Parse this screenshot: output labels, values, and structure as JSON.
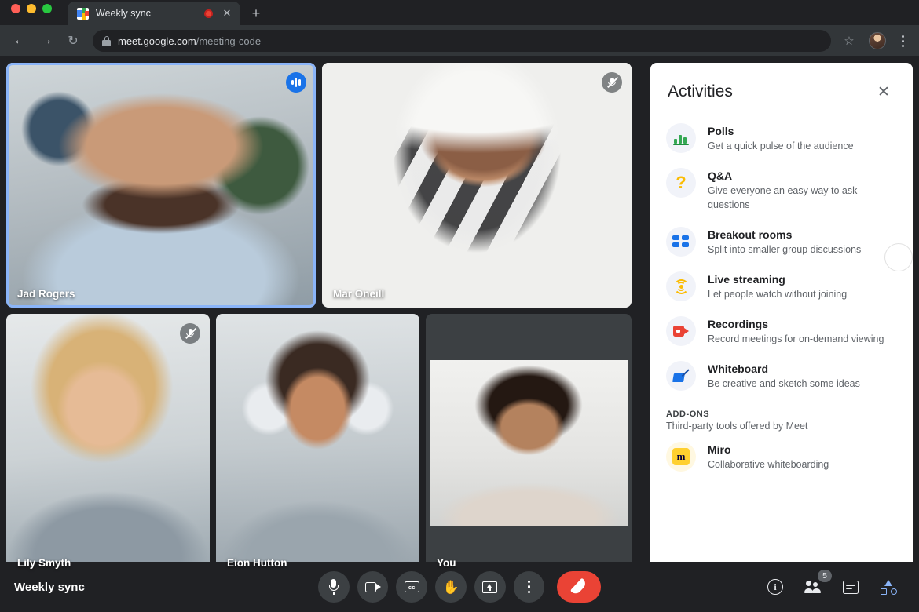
{
  "browser": {
    "tab": {
      "title": "Weekly sync",
      "favicon": "google-meet-favicon",
      "recording_indicator": "recording-dot",
      "close": "✕"
    },
    "new_tab": "+",
    "nav": {
      "back": "←",
      "forward": "→",
      "reload": "↻"
    },
    "omnibox": {
      "lock": "lock-icon",
      "domain": "meet.google.com",
      "path": "/meeting-code",
      "star": "☆"
    },
    "menu": "kebab-menu"
  },
  "meeting": {
    "title": "Weekly sync",
    "tiles": [
      {
        "name": "Jad Rogers",
        "mic": "on",
        "speaking": true,
        "style": "p-jad"
      },
      {
        "name": "Mar Oneill",
        "mic": "off",
        "speaking": false,
        "style": "p-mar"
      },
      {
        "name": "Lily Smyth",
        "mic": "off",
        "speaking": false,
        "style": "p-lily"
      },
      {
        "name": "Eion Hutton",
        "mic": "none",
        "speaking": false,
        "style": "p-eion"
      },
      {
        "name": "You",
        "mic": "none",
        "speaking": false,
        "style": "p-you"
      }
    ]
  },
  "panel": {
    "title": "Activities",
    "close_label": "✕",
    "items": [
      {
        "title": "Polls",
        "subtitle": "Get a quick pulse of the audience",
        "icon": "polls-icon"
      },
      {
        "title": "Q&A",
        "subtitle": "Give everyone an easy way to ask questions",
        "icon": "qa-icon"
      },
      {
        "title": "Breakout rooms",
        "subtitle": "Split into smaller group discussions",
        "icon": "breakout-rooms-icon"
      },
      {
        "title": "Live streaming",
        "subtitle": "Let people watch without joining",
        "icon": "live-streaming-icon"
      },
      {
        "title": "Recordings",
        "subtitle": "Record meetings for on-demand viewing",
        "icon": "recordings-icon"
      },
      {
        "title": "Whiteboard",
        "subtitle": "Be creative and sketch some ideas",
        "icon": "whiteboard-icon"
      }
    ],
    "addons": {
      "label": "ADD-ONS",
      "subtitle": "Third-party tools offered by Meet",
      "items": [
        {
          "title": "Miro",
          "subtitle": "Collaborative whiteboarding",
          "icon": "miro-icon",
          "glyph": "m"
        }
      ]
    }
  },
  "toolbar": {
    "center": [
      {
        "name": "microphone-button",
        "icon": "mic-icon"
      },
      {
        "name": "camera-button",
        "icon": "camera-icon"
      },
      {
        "name": "captions-button",
        "icon": "cc-icon",
        "glyph": "cc"
      },
      {
        "name": "raise-hand-button",
        "icon": "hand-icon",
        "glyph": "✋"
      },
      {
        "name": "present-screen-button",
        "icon": "present-icon"
      },
      {
        "name": "more-options-button",
        "icon": "more-vertical-icon"
      },
      {
        "name": "leave-call-button",
        "icon": "hangup-icon"
      }
    ],
    "right": [
      {
        "name": "meeting-details-button",
        "icon": "info-icon",
        "glyph": "i"
      },
      {
        "name": "participants-button",
        "icon": "people-icon",
        "badge": "5"
      },
      {
        "name": "chat-button",
        "icon": "chat-icon"
      },
      {
        "name": "activities-button",
        "icon": "activities-icon",
        "active": true
      }
    ]
  },
  "colors": {
    "accent_blue": "#8ab4f8",
    "mic_on_blue": "#1a73e8",
    "hangup_red": "#ea4335",
    "chrome_dark": "#202124",
    "panel_white": "#ffffff"
  }
}
